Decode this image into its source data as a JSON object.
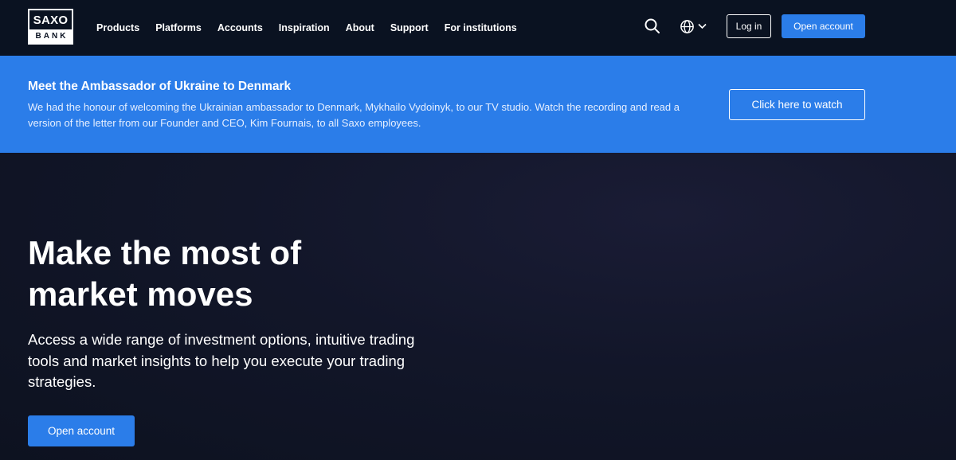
{
  "brand": {
    "logo_top": "SAXO",
    "logo_bottom": "BANK"
  },
  "nav": {
    "items": [
      {
        "label": "Products"
      },
      {
        "label": "Platforms"
      },
      {
        "label": "Accounts"
      },
      {
        "label": "Inspiration"
      },
      {
        "label": "About"
      },
      {
        "label": "Support"
      },
      {
        "label": "For institutions"
      }
    ],
    "search_icon": "search-icon",
    "language_icon": "globe-icon",
    "login_label": "Log in",
    "open_account_label": "Open account"
  },
  "banner": {
    "title": "Meet the Ambassador of Ukraine to Denmark",
    "text": "We had the honour of welcoming the Ukrainian ambassador to Denmark, Mykhailo Vydoinyk, to our TV studio. Watch the recording and read a version of the letter from our Founder and CEO, Kim Fournais, to all Saxo employees.",
    "button_label": "Click here to watch"
  },
  "hero": {
    "title": "Make the most of market moves",
    "subtitle": "Access a wide range of investment options, intuitive trading tools and market insights to help you execute your trading strategies.",
    "cta_label": "Open account"
  },
  "colors": {
    "nav_bg": "#0a1221",
    "accent": "#2b7de9",
    "hero_bg": "#121629"
  }
}
